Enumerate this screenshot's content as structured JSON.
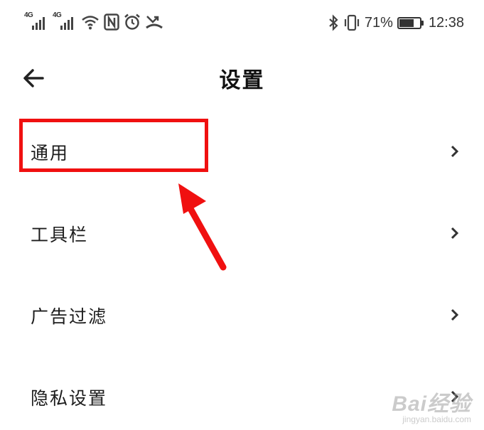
{
  "status_bar": {
    "signal_1_type": "4G",
    "signal_2_type": "4G",
    "battery_percent": "71%",
    "battery_level": 0.71,
    "time": "12:38",
    "icons": [
      "signal-icon",
      "signal-icon",
      "wifi-icon",
      "nfc-icon",
      "alarm-icon",
      "missed-call-icon",
      "bluetooth-icon",
      "vibrate-icon",
      "battery-icon"
    ]
  },
  "header": {
    "title": "设置",
    "back_icon": "back-arrow-icon"
  },
  "settings": {
    "items": [
      {
        "label": "通用"
      },
      {
        "label": "工具栏"
      },
      {
        "label": "广告过滤"
      },
      {
        "label": "隐私设置"
      }
    ]
  },
  "annotation": {
    "highlighted_item": "通用",
    "color": "#f01010"
  },
  "watermark": {
    "brand": "Bai经验",
    "site": "jingyan.baidu.com"
  }
}
